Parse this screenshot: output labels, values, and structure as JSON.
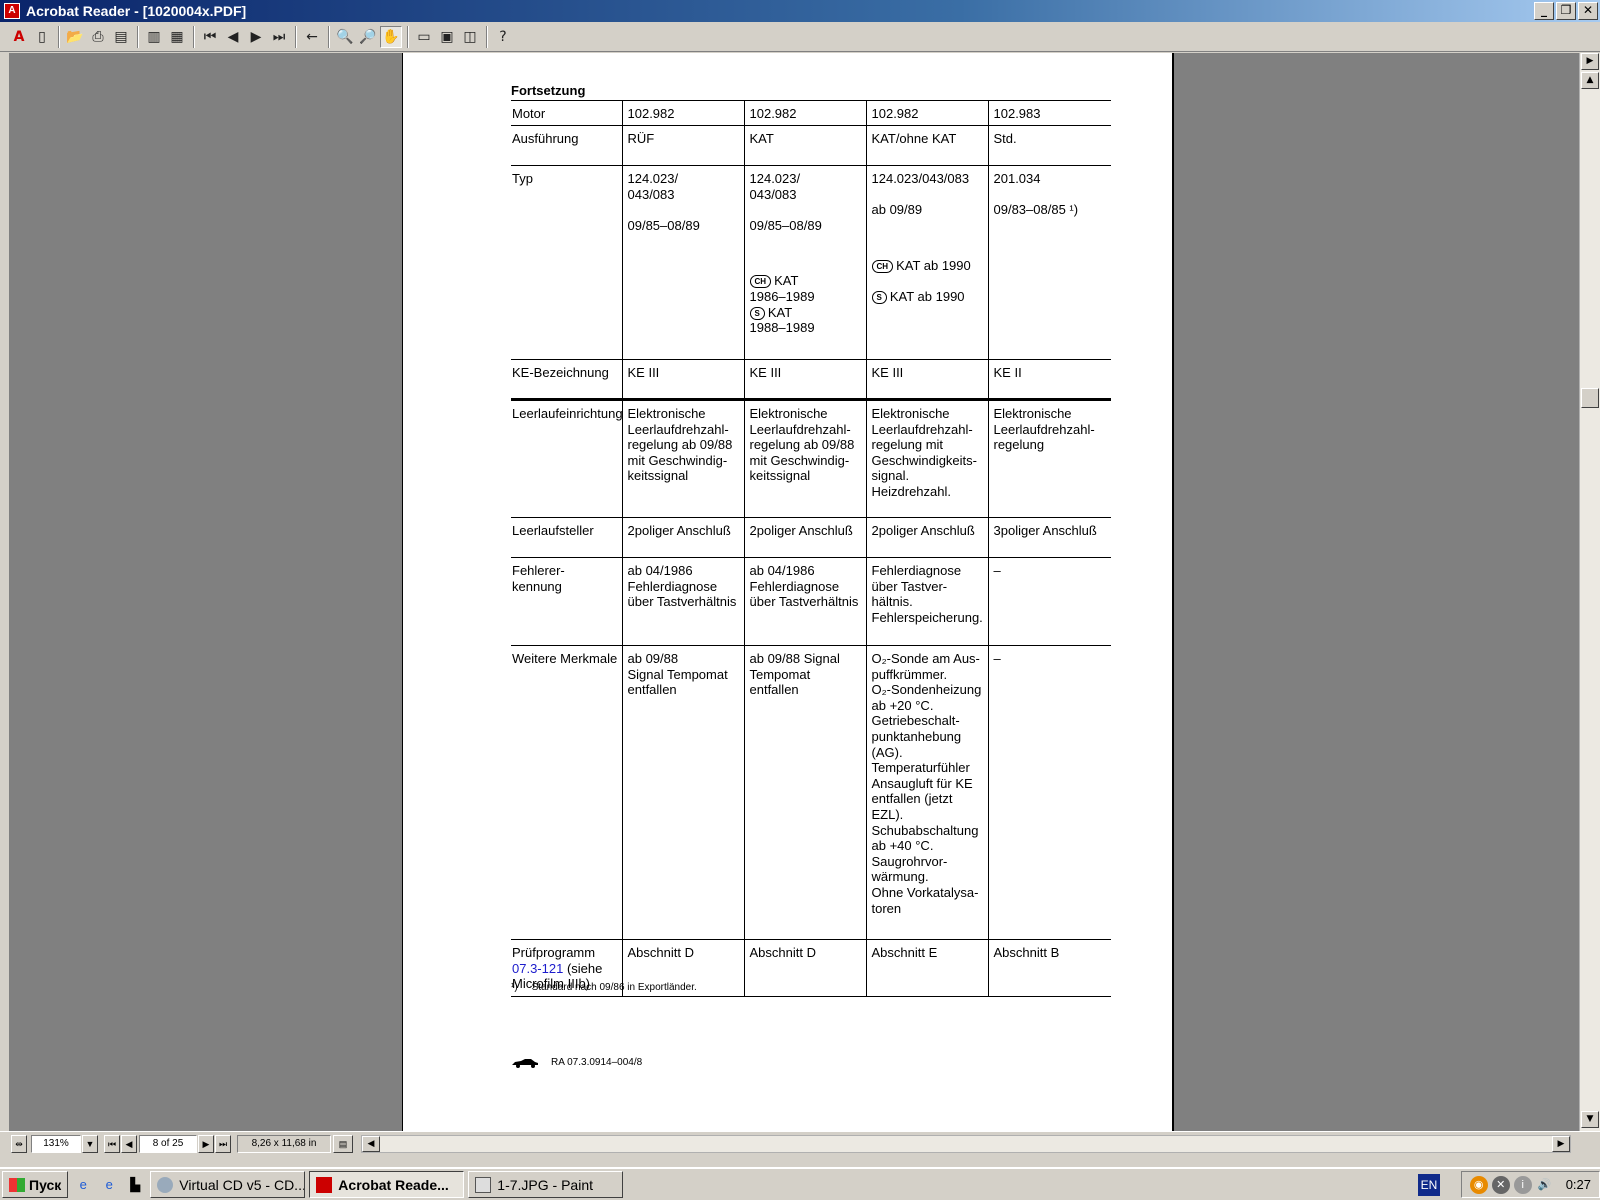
{
  "window": {
    "title": "Acrobat Reader - [1020004x.PDF]"
  },
  "toolbar": {
    "buttons": [
      "acrobat-logo-icon",
      "bookmark-pane-icon",
      "open-icon",
      "print-icon",
      "properties-icon",
      "first-page-icon",
      "prev-page-icon",
      "next-page-icon",
      "last-page-icon",
      "go-back-icon",
      "zoom-out-icon",
      "zoom-in-icon",
      "hand-tool-icon",
      "actual-size-icon",
      "fit-page-icon",
      "fit-width-icon",
      "help-icon"
    ],
    "help_label": "?"
  },
  "document": {
    "continuation_title": "Fortsetzung",
    "table": {
      "row_motor": {
        "label": "Motor",
        "c1": "102.982",
        "c2": "102.982",
        "c3": "102.982",
        "c4": "102.983"
      },
      "row_ausfuehrung": {
        "label": "Ausführung",
        "c1": "RÜF",
        "c2": "KAT",
        "c3": "KAT/ohne KAT",
        "c4": "Std."
      },
      "row_typ": {
        "label": "Typ",
        "c1": "124.023/\n043/083\n\n09/85–08/89",
        "c2": "124.023/\n043/083\n\n09/85–08/89",
        "c2_badge1": "CH",
        "c2_note1": "KAT\n1986–1989",
        "c2_badge2": "S",
        "c2_note2": "KAT\n1988–1989",
        "c3": "124.023/043/083\n\nab 09/89",
        "c3_badge1": "CH",
        "c3_note1": "KAT ab 1990",
        "c3_badge2": "S",
        "c3_note2": "KAT ab 1990",
        "c4": "201.034\n\n09/83–08/85 ¹)"
      },
      "row_ke": {
        "label": "KE-Bezeichnung",
        "c1": "KE III",
        "c2": "KE III",
        "c3": "KE III",
        "c4": "KE II"
      },
      "row_leerlauf": {
        "label": "Leerlaufeinrichtung",
        "c1": "Elektronische\nLeerlaufdrehzahl-\nregelung ab 09/88\nmit Geschwindig-\nkeitssignal",
        "c2": "Elektronische\nLeerlaufdrehzahl-\nregelung ab 09/88\nmit Geschwindig-\nkeitssignal",
        "c3": "Elektronische\nLeerlaufdrehzahl-\nregelung mit\nGeschwindigkeits-\nsignal.\nHeizdrehzahl.",
        "c4": "Elektronische\nLeerlaufdrehzahl-\nregelung"
      },
      "row_steller": {
        "label": "Leerlaufsteller",
        "c1": "2poliger Anschluß",
        "c2": "2poliger Anschluß",
        "c3": "2poliger Anschluß",
        "c4": "3poliger Anschluß"
      },
      "row_fehler": {
        "label": "Fehlerer-\nkennung",
        "c1": "ab 04/1986\nFehlerdiagnose\nüber Tastverhältnis",
        "c2": "ab 04/1986\nFehlerdiagnose\nüber Tastverhältnis",
        "c3": "Fehlerdiagnose\nüber Tastver-\nhältnis.\nFehlerspeicherung.",
        "c4": "–"
      },
      "row_merkmale": {
        "label": "Weitere Merkmale",
        "c1": "ab 09/88\nSignal Tempomat\nentfallen",
        "c2": "ab 09/88 Signal\nTempomat\nentfallen",
        "c3": "O₂-Sonde am Aus-\npuffkrümmer.\nO₂-Sondenheizung\nab +20 °C.\nGetriebeschalt-\npunktanhebung\n(AG).\nTemperaturfühler\nAnsaugluft für KE\nentfallen (jetzt\nEZL).\nSchubabschaltung\nab +40 °C.\nSaugrohrvor-\nwärmung.\nOhne Vorkatalysa-\ntoren",
        "c4": "–"
      },
      "row_pruef": {
        "label_a": "Prüfprogramm",
        "label_link": "07.3-121",
        "label_b": " (siehe\nMicrofilm IIIb)",
        "c1": "Abschnitt D",
        "c2": "Abschnitt D",
        "c3": "Abschnitt E",
        "c4": "Abschnitt B"
      }
    },
    "footnote_mark": "¹)",
    "footnote_text": "Standard nach 09/86 in Exportländer.",
    "doc_ref": "RA 07.3.0914–004/8"
  },
  "statusbar": {
    "zoom": "131%",
    "page": "8 of 25",
    "page_size": "8,26 x 11,68 in"
  },
  "taskbar": {
    "start_label": "Пуск",
    "tasks": [
      {
        "label": "Virtual CD v5 - CD...",
        "active": false
      },
      {
        "label": "Acrobat Reade...",
        "active": true
      },
      {
        "label": "1-7.JPG - Paint",
        "active": false
      }
    ],
    "language": "EN",
    "clock": "0:27"
  }
}
